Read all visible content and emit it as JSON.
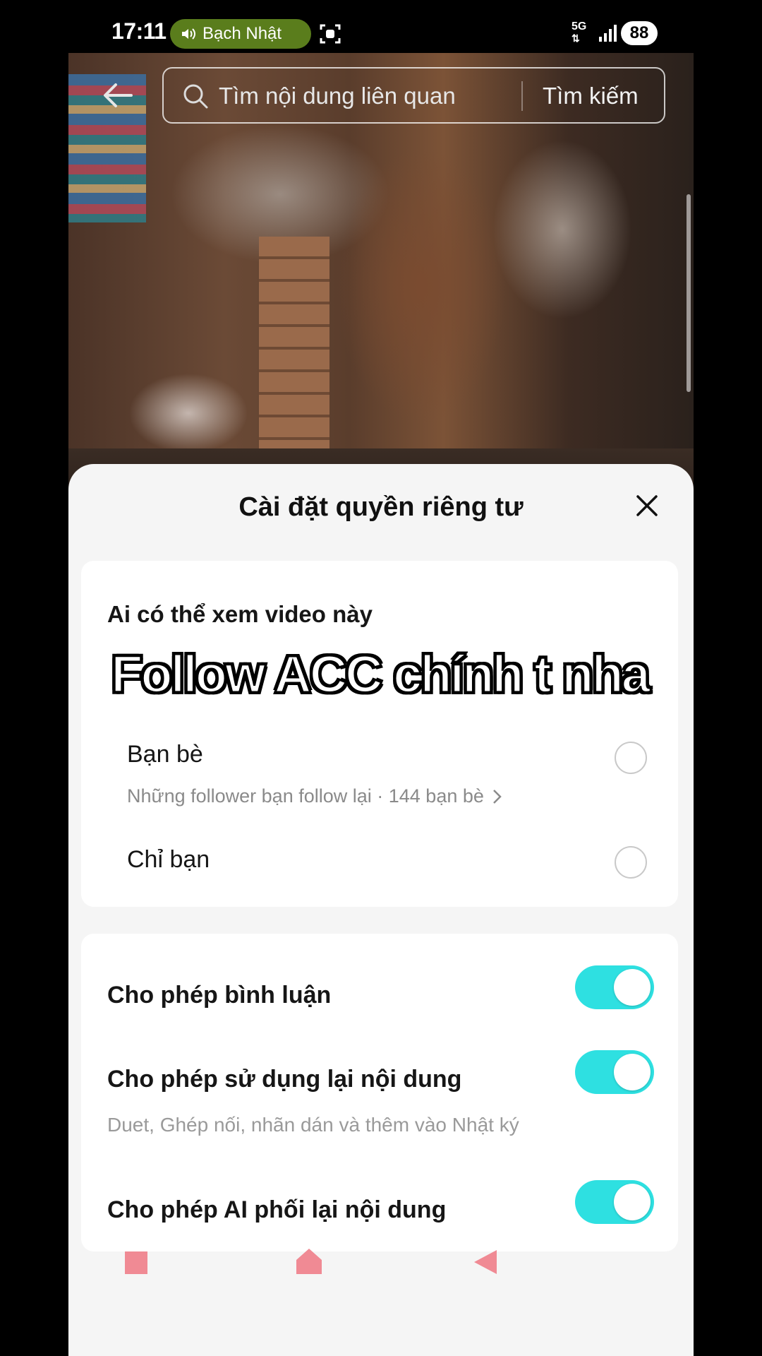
{
  "status_bar": {
    "time": "17:11",
    "audio_pill": "Bạch Nhật",
    "network": "5G",
    "battery": "88"
  },
  "search": {
    "placeholder": "Tìm nội dung liên quan",
    "button_label": "Tìm kiếm"
  },
  "sheet": {
    "title": "Cài đặt quyền riêng tư",
    "visibility": {
      "question": "Ai có thể xem video này",
      "overlay_caption": "Follow ACC chính t nha",
      "options": [
        {
          "label": "Bạn bè",
          "sub": "Những follower bạn follow lại · 144 bạn bè",
          "selected": false
        },
        {
          "label": "Chỉ bạn",
          "selected": false
        }
      ]
    },
    "settings": [
      {
        "label": "Cho phép bình luận",
        "enabled": true
      },
      {
        "label": "Cho phép sử dụng lại nội dung",
        "sub": "Duet, Ghép nối, nhãn dán và thêm vào Nhật ký",
        "enabled": true
      },
      {
        "label": "Cho phép AI phối lại nội dung",
        "enabled": true
      }
    ]
  },
  "colors": {
    "toggle_on": "#2ee0e1",
    "audio_pill": "#5a7d1c",
    "nav_icons": "#f08a94"
  }
}
